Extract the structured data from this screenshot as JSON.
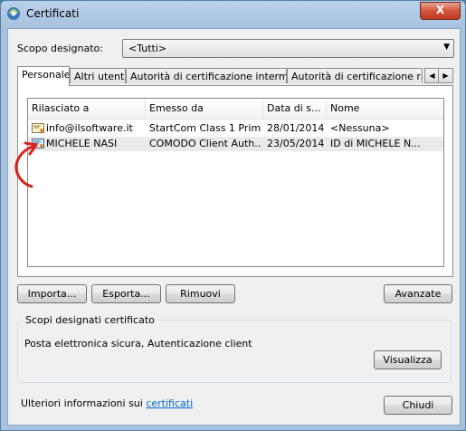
{
  "window": {
    "title": "Certificati",
    "close_label": "X"
  },
  "scope": {
    "label": "Scopo designato:",
    "value": "<Tutti>"
  },
  "tabs": [
    {
      "label": "Personale"
    },
    {
      "label": "Altri utenti"
    },
    {
      "label": "Autorità di certificazione intermedie"
    },
    {
      "label": "Autorità di certificazione radice"
    }
  ],
  "list": {
    "columns": [
      "Rilasciato a",
      "Emesso da",
      "Data di s...",
      "Nome"
    ],
    "rows": [
      {
        "issued_to": "info@ilsoftware.it",
        "issued_by": "StartCom Class 1 Prim...",
        "expiry": "28/01/2014",
        "name": "<Nessuna>"
      },
      {
        "issued_to": "MICHELE NASI",
        "issued_by": "COMODO Client Auth...",
        "expiry": "23/05/2014",
        "name": "ID di MICHELE N..."
      }
    ]
  },
  "buttons": {
    "import": "Importa...",
    "export": "Esporta...",
    "remove": "Rimuovi",
    "advanced": "Avanzate",
    "view": "Visualizza",
    "close": "Chiudi"
  },
  "purposes": {
    "title": "Scopi designati certificato",
    "value": "Posta elettronica sicura, Autenticazione client"
  },
  "more_info": {
    "text": "Ulteriori informazioni sui ",
    "link": "certificati"
  },
  "colors": {
    "selection": "#eaeaea",
    "annotation": "#d8231f",
    "link": "#0066cc"
  }
}
